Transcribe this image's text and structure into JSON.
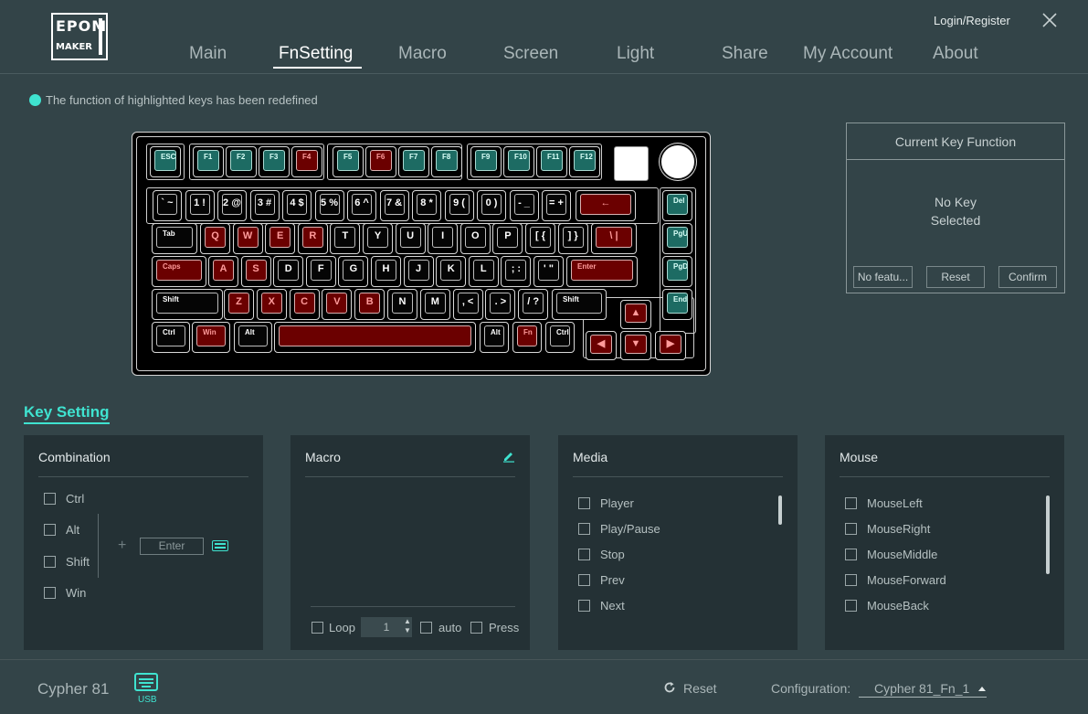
{
  "logo": {
    "line1": "EPOM",
    "line2": "MAKER"
  },
  "header": {
    "login": "Login/Register",
    "nav": [
      "Main",
      "FnSetting",
      "Macro",
      "Screen",
      "Light",
      "Share",
      "My Account",
      "About"
    ],
    "active_tab": "FnSetting"
  },
  "hint": "The function of highlighted keys has been redefined",
  "keyboard": {
    "row_f": [
      "ESC",
      "F1",
      "F2",
      "F3",
      "F4",
      "F5",
      "F6",
      "F7",
      "F8",
      "F9",
      "F10",
      "F11",
      "F12"
    ],
    "row_num": [
      "` ~",
      "1 !",
      "2 @",
      "3 #",
      "4 $",
      "5 %",
      "6 ^",
      "7 &",
      "8 *",
      "9 (",
      "0 )",
      "- _",
      "= +",
      "←"
    ],
    "row_q": [
      "Tab",
      "Q",
      "W",
      "E",
      "R",
      "T",
      "Y",
      "U",
      "I",
      "O",
      "P",
      "[ {",
      "] }",
      "\\ |"
    ],
    "row_a": [
      "Caps",
      "A",
      "S",
      "D",
      "F",
      "G",
      "H",
      "J",
      "K",
      "L",
      "; :",
      "' \"",
      "Enter"
    ],
    "row_z": [
      "Shift",
      "Z",
      "X",
      "C",
      "V",
      "B",
      "N",
      "M",
      ", <",
      ". >",
      "/ ?",
      "Shift"
    ],
    "row_bottom": [
      "Ctrl",
      "Win",
      "Alt",
      "",
      "Alt",
      "Fn",
      "Ctrl"
    ],
    "nav_keys": [
      "Del",
      "PgUp",
      "PgDn",
      "End"
    ],
    "arrows": [
      "▲",
      "◀",
      "▼",
      "▶"
    ]
  },
  "current_key": {
    "title": "Current Key Function",
    "body_line1": "No Key",
    "body_line2": "Selected",
    "btn_nofeature": "No featu...",
    "btn_reset": "Reset",
    "btn_confirm": "Confirm"
  },
  "key_setting": {
    "title": "Key Setting",
    "combination": {
      "title": "Combination",
      "mods": [
        "Ctrl",
        "Alt",
        "Shift",
        "Win"
      ],
      "plus": "+",
      "enter_placeholder": "Enter"
    },
    "macro": {
      "title": "Macro",
      "loop": "Loop",
      "loop_count": "1",
      "auto": "auto",
      "press": "Press"
    },
    "media": {
      "title": "Media",
      "items": [
        "Player",
        "Play/Pause",
        "Stop",
        "Prev",
        "Next"
      ]
    },
    "mouse": {
      "title": "Mouse",
      "items": [
        "MouseLeft",
        "MouseRight",
        "MouseMiddle",
        "MouseForward",
        "MouseBack"
      ]
    }
  },
  "footer": {
    "device": "Cypher 81",
    "usb": "USB",
    "reset": "Reset",
    "config_label": "Configuration:",
    "config_value": "Cypher 81_Fn_1"
  },
  "colors": {
    "accent": "#3fe3d0",
    "remapped_key": "#6b0000",
    "teal_key": "#1d6b63",
    "bg": "#334448",
    "panel": "#243135"
  }
}
